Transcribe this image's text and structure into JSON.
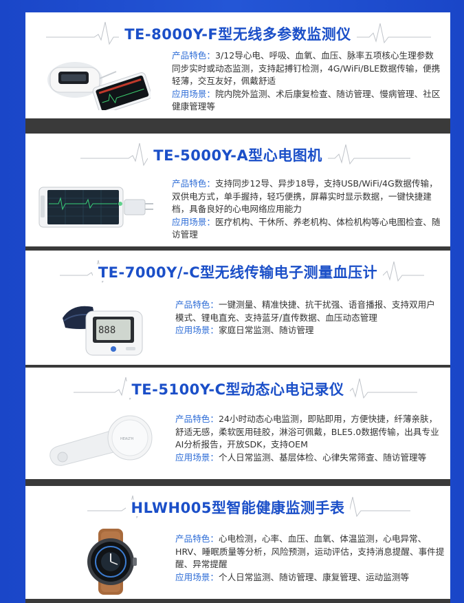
{
  "products": [
    {
      "title": "TE-8000Y-F型无线多参数监测仪",
      "feature_label": "产品特色：",
      "feature_text": "3/12导心电、呼吸、血氧、血压、脉率五项核心生理参数同步实时或动态监测，支持起搏钉检测，4G/WiFi/BLE数据传输，便携轻薄，交互友好，佩戴舒适",
      "scene_label": "应用场景：",
      "scene_text": "院内院外监测、术后康复检查、随访管理、慢病管理、社区健康管理等",
      "image_icon": "multi-parameter-monitor-with-phone"
    },
    {
      "title": "TE-5000Y-A型心电图机",
      "feature_label": "产品特色：",
      "feature_text": "支持同步12导、异步18导，支持USB/WiFi/4G数据传输，双供电方式，单手握持，轻巧便携，屏幕实时显示数据，一键快捷建档，具备良好的心电网络应用能力",
      "scene_label": "应用场景：",
      "scene_text": "医疗机构、干休所、养老机构、体检机构等心电图检查、随访管理",
      "image_icon": "ecg-tablet-device"
    },
    {
      "title": "TE-7000Y/-C型无线传输电子测量血压计",
      "feature_label": "产品特色：",
      "feature_text": "一键测量、精准快捷、抗干扰强、语音播报、支持双用户模式、锂电直充、支持蓝牙/直传数据、血压动态管理",
      "scene_label": "应用场景：",
      "scene_text": "家庭日常监测、随访管理",
      "image_icon": "blood-pressure-monitor"
    },
    {
      "title": "TE-5100Y-C型动态心电记录仪",
      "feature_label": "产品特色：",
      "feature_text": "24小时动态心电监测，即贴即用，方便快捷，纤薄亲肤，舒适无感，柔软医用硅胶，淋浴可佩戴，BLE5.0数据传输，出具专业AI分析报告，开放SDK，支持OEM",
      "scene_label": "应用场景：",
      "scene_text": "个人日常监测、基层体检、心律失常筛查、随访管理等",
      "image_icon": "ecg-patch-recorder"
    },
    {
      "title": "HLWH005型智能健康监测手表",
      "feature_label": "产品特色：",
      "feature_text": "心电检测，心率、血压、血氧、体温监测，心电异常、HRV、睡眠质量等分析，风险预测，运动评估，支持消息提醒、事件提醒、异常提醒",
      "scene_label": "应用场景：",
      "scene_text": "个人日常监测、随访管理、康复管理、运动监测等",
      "image_icon": "smart-health-watch"
    }
  ]
}
